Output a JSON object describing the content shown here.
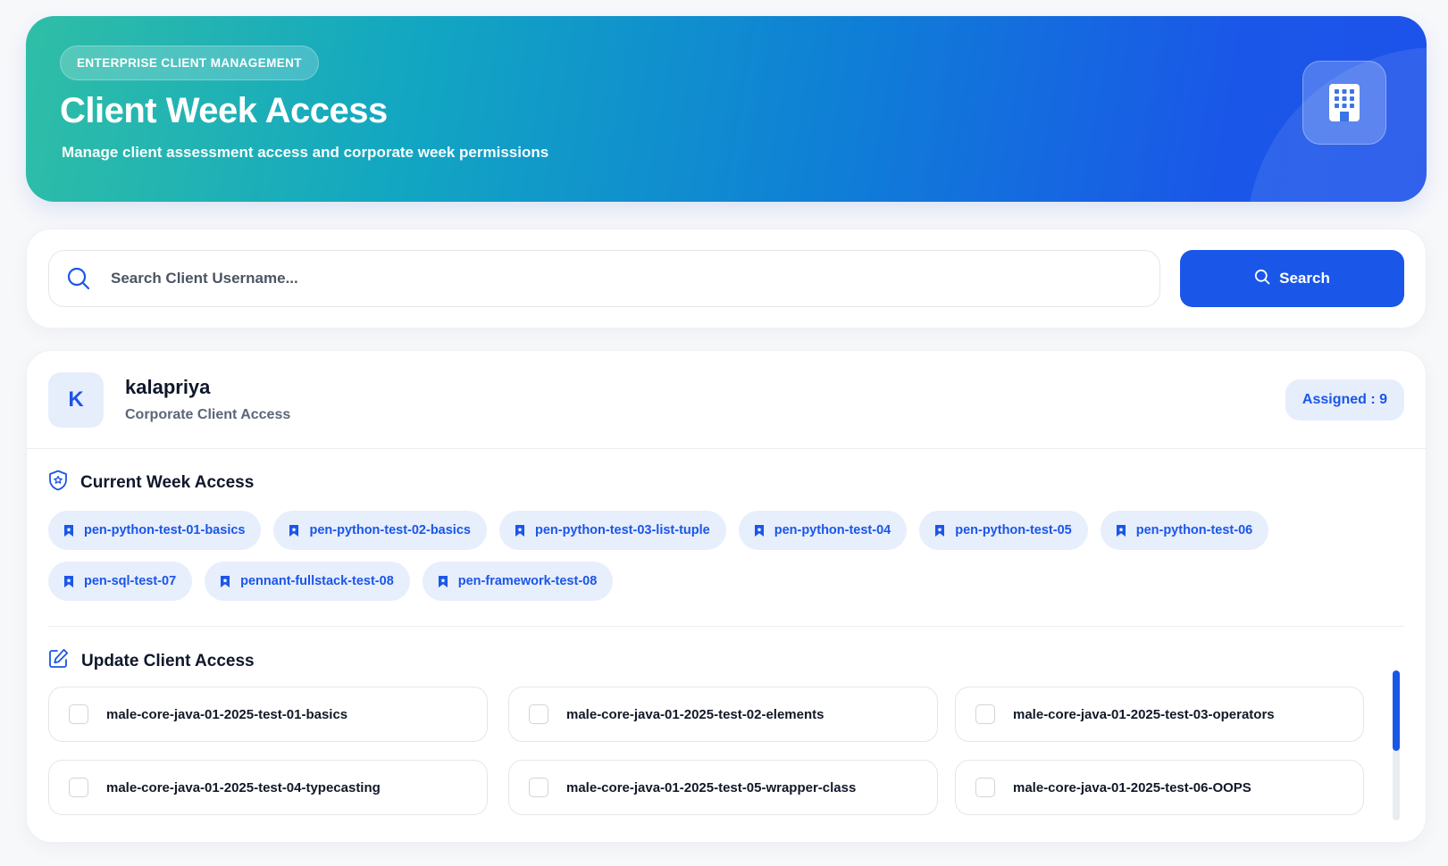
{
  "header": {
    "badge": "ENTERPRISE CLIENT MANAGEMENT",
    "title": "Client Week Access",
    "subtitle": "Manage client assessment access and corporate week permissions",
    "icon": "building-icon"
  },
  "search": {
    "placeholder": "Search Client Username...",
    "value": "",
    "button_label": "Search"
  },
  "client": {
    "avatar_letter": "K",
    "name": "kalapriya",
    "subtitle": "Corporate Client Access",
    "assigned_label": "Assigned : 9"
  },
  "current_access": {
    "title": "Current Week Access",
    "tags": [
      "pen-python-test-01-basics",
      "pen-python-test-02-basics",
      "pen-python-test-03-list-tuple",
      "pen-python-test-04",
      "pen-python-test-05",
      "pen-python-test-06",
      "pen-sql-test-07",
      "pennant-fullstack-test-08",
      "pen-framework-test-08"
    ]
  },
  "update_access": {
    "title": "Update Client Access",
    "options": [
      {
        "label": "male-core-java-01-2025-test-01-basics",
        "checked": false
      },
      {
        "label": "male-core-java-01-2025-test-02-elements",
        "checked": false
      },
      {
        "label": "male-core-java-01-2025-test-03-operators",
        "checked": false
      },
      {
        "label": "male-core-java-01-2025-test-04-typecasting",
        "checked": false
      },
      {
        "label": "male-core-java-01-2025-test-05-wrapper-class",
        "checked": false
      },
      {
        "label": "male-core-java-01-2025-test-06-OOPS",
        "checked": false
      }
    ]
  },
  "colors": {
    "primary": "#1a56e8",
    "tag_bg": "#e7eefc",
    "hero_start": "#2fbea6",
    "hero_end": "#1d52ea"
  }
}
